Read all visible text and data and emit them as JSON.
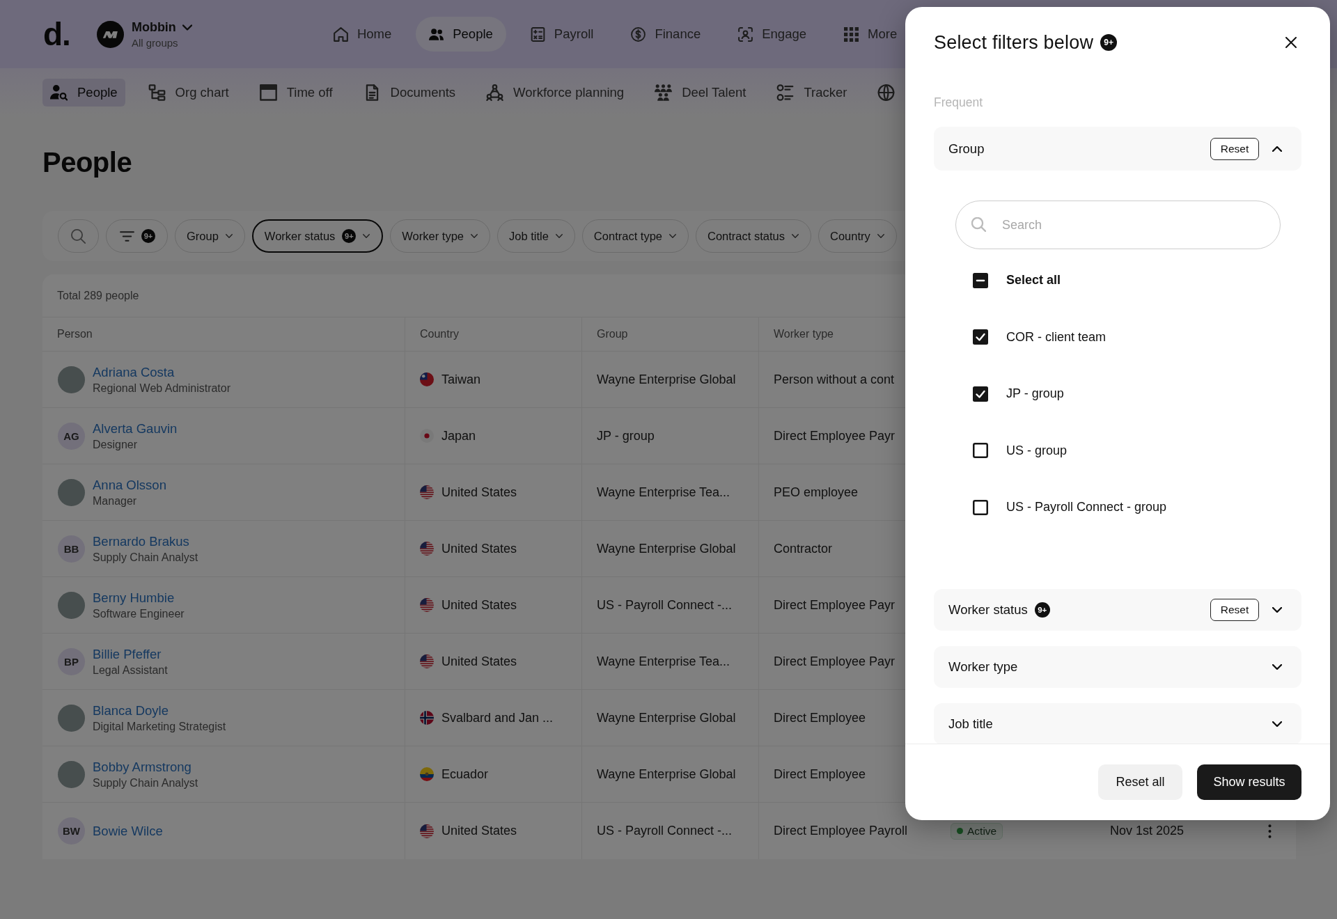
{
  "top_nav": {
    "logo": "d.",
    "workspace": {
      "name": "Mobbin",
      "subtitle": "All groups"
    },
    "tabs": [
      {
        "label": "Home",
        "selected": false
      },
      {
        "label": "People",
        "selected": true
      },
      {
        "label": "Payroll",
        "selected": false
      },
      {
        "label": "Finance",
        "selected": false
      },
      {
        "label": "Engage",
        "selected": false
      },
      {
        "label": "More",
        "selected": false
      }
    ]
  },
  "sub_nav": {
    "items": [
      {
        "label": "People",
        "selected": true
      },
      {
        "label": "Org chart",
        "selected": false
      },
      {
        "label": "Time off",
        "selected": false
      },
      {
        "label": "Documents",
        "selected": false
      },
      {
        "label": "Workforce planning",
        "selected": false
      },
      {
        "label": "Deel Talent",
        "selected": false
      },
      {
        "label": "Tracker",
        "selected": false
      },
      {
        "selected": false
      }
    ]
  },
  "page_title": "People",
  "filter_bar": {
    "chips": [
      {
        "kind": "search"
      },
      {
        "kind": "filters",
        "badge": "9+"
      },
      {
        "kind": "dropdown",
        "label": "Group",
        "selected": false
      },
      {
        "kind": "dropdown",
        "label": "Worker status",
        "badge": "9+",
        "selected": true
      },
      {
        "kind": "dropdown",
        "label": "Worker type",
        "selected": false
      },
      {
        "kind": "dropdown",
        "label": "Job title",
        "selected": false
      },
      {
        "kind": "dropdown",
        "label": "Contract type",
        "selected": false
      },
      {
        "kind": "dropdown",
        "label": "Contract status",
        "selected": false
      },
      {
        "kind": "dropdown",
        "label": "Country",
        "selected": false
      }
    ]
  },
  "table": {
    "total": "Total 289 people",
    "columns": [
      "Person",
      "Country",
      "Group",
      "Worker type"
    ],
    "rows": [
      {
        "person": {
          "name": "Adriana Costa",
          "title": "Regional Web Administrator",
          "avatar": {
            "kind": "photo"
          }
        },
        "country": "Taiwan",
        "group": "Wayne Enterprise Global",
        "worker_type": "Person without a cont"
      },
      {
        "person": {
          "name": "Alverta Gauvin",
          "title": "Designer",
          "avatar": {
            "kind": "initials",
            "text": "AG"
          }
        },
        "country": "Japan",
        "group": "JP - group",
        "worker_type": "Direct Employee Payr"
      },
      {
        "person": {
          "name": "Anna Olsson",
          "title": "Manager",
          "avatar": {
            "kind": "photo"
          }
        },
        "country": "United States",
        "group": "Wayne Enterprise Tea...",
        "worker_type": "PEO employee"
      },
      {
        "person": {
          "name": "Bernardo Brakus",
          "title": "Supply Chain Analyst",
          "avatar": {
            "kind": "initials",
            "text": "BB"
          }
        },
        "country": "United States",
        "group": "Wayne Enterprise Global",
        "worker_type": "Contractor"
      },
      {
        "person": {
          "name": "Berny Humbie",
          "title": "Software Engineer",
          "avatar": {
            "kind": "photo"
          }
        },
        "country": "United States",
        "group": "US - Payroll Connect -...",
        "worker_type": "Direct Employee Payr"
      },
      {
        "person": {
          "name": "Billie Pfeffer",
          "title": "Legal Assistant",
          "avatar": {
            "kind": "initials",
            "text": "BP"
          }
        },
        "country": "United States",
        "group": "Wayne Enterprise Tea...",
        "worker_type": "Direct Employee Payr"
      },
      {
        "person": {
          "name": "Blanca Doyle",
          "title": "Digital Marketing Strategist",
          "avatar": {
            "kind": "photo"
          }
        },
        "country": "Svalbard and Jan ...",
        "group": "Wayne Enterprise Global",
        "worker_type": "Direct Employee"
      },
      {
        "person": {
          "name": "Bobby Armstrong",
          "title": "Supply Chain Analyst",
          "avatar": {
            "kind": "photo"
          }
        },
        "country": "Ecuador",
        "group": "Wayne Enterprise Global",
        "worker_type": "Direct Employee"
      },
      {
        "person": {
          "name": "Bowie Wilce",
          "avatar": {
            "kind": "initials",
            "text": "BW"
          }
        },
        "country": "United States",
        "group": "US - Payroll Connect -...",
        "worker_type": "Direct Employee Payroll",
        "status": {
          "label": "Active"
        },
        "start_date": "Nov 1st 2025",
        "actions": true
      }
    ]
  },
  "filter_panel": {
    "title": "Select filters below",
    "badge": "9+",
    "group_label": "Frequent",
    "sections": [
      {
        "label": "Group",
        "reset": "Reset",
        "expanded": true,
        "search_placeholder": "Search",
        "select_all": {
          "label": "Select all",
          "indeterminate": true
        },
        "options": [
          {
            "label": "COR - client team",
            "checked": true
          },
          {
            "label": "JP - group",
            "checked": true
          },
          {
            "label": "US - group",
            "checked": false
          },
          {
            "label": "US - Payroll Connect - group",
            "checked": false
          }
        ]
      },
      {
        "label": "Worker status",
        "badge": "9+",
        "reset": "Reset",
        "expanded": false
      },
      {
        "label": "Worker type",
        "expanded": false
      },
      {
        "label": "Job title",
        "expanded": false
      }
    ],
    "buttons": [
      {
        "label": "Reset all",
        "kind": "secondary"
      },
      {
        "label": "Show results",
        "kind": "primary"
      }
    ]
  }
}
